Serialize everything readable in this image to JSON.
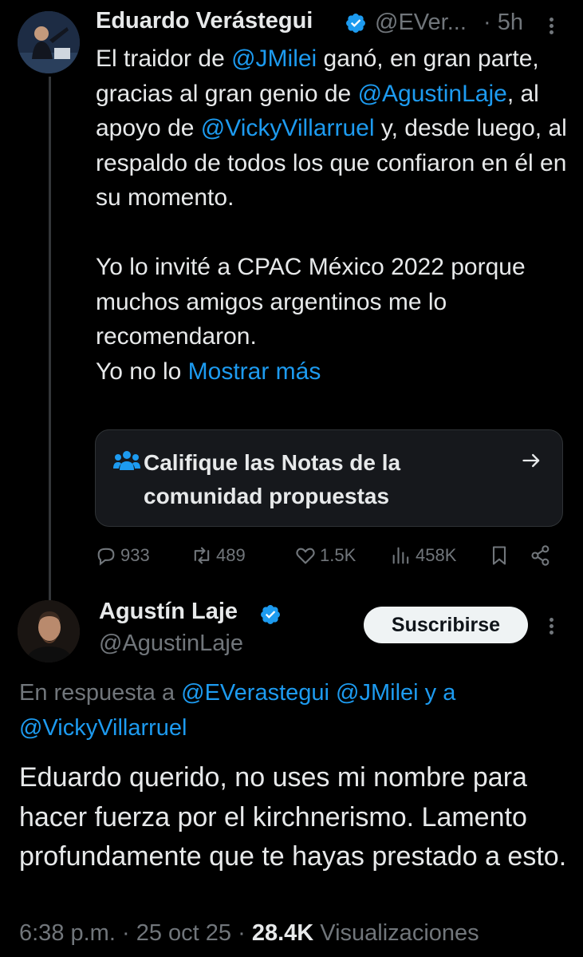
{
  "colors": {
    "background": "#000000",
    "text_primary": "#e7e9ea",
    "text_secondary": "#71767b",
    "link": "#1d9bf0",
    "verified": "#1d9bf0",
    "card_bg": "#16181c",
    "button_bg": "#eff3f4"
  },
  "tweet1": {
    "author_name": "Eduardo Verástegui",
    "author_handle": "@EVer...",
    "time": "· 5h",
    "text": {
      "p1_pre": "El traidor de ",
      "mention1": "@JMilei",
      "p1_mid1": " ganó, en gran parte, gracias al gran genio de ",
      "mention2": "@AgustinLaje",
      "p1_mid2": ", al apoyo de ",
      "mention3": "@VickyVillarruel",
      "p1_end": " y, desde luego, al respaldo de todos los que confiaron en él en su momento.",
      "p2": "Yo lo invité a CPAC México 2022 porque muchos amigos argentinos me lo recomendaron.",
      "p3_pre": "Yo no lo ",
      "show_more": "Mostrar más"
    },
    "community_notes_card": {
      "icon": "people-icon",
      "label": "Califique las Notas de la comunidad propuestas",
      "arrow_icon": "arrow-right-icon"
    },
    "actions": {
      "replies": "933",
      "reposts": "489",
      "likes": "1.5K",
      "views": "458K",
      "bookmark_icon": "bookmark-icon",
      "share_icon": "share-icon"
    }
  },
  "tweet2": {
    "author_name": "Agustín Laje",
    "author_handle": "@AgustinLaje",
    "subscribe_label": "Suscribirse",
    "reply_to": {
      "prefix": "En respuesta a ",
      "mention1": "@EVerastegui",
      "mention2": "@JMilei",
      "and": "y a",
      "mention3": "@VickyVillarruel"
    },
    "text": "Eduardo querido, no uses mi nombre para hacer fuerza por el kirchnerismo. Lamento profundamente que te hayas prestado a esto.",
    "meta": {
      "time": "6:38 p.m.",
      "sep1": "·",
      "date": "25 oct 25",
      "sep2": "·",
      "views_count": "28.4K",
      "views_label": "Visualizaciones"
    }
  }
}
